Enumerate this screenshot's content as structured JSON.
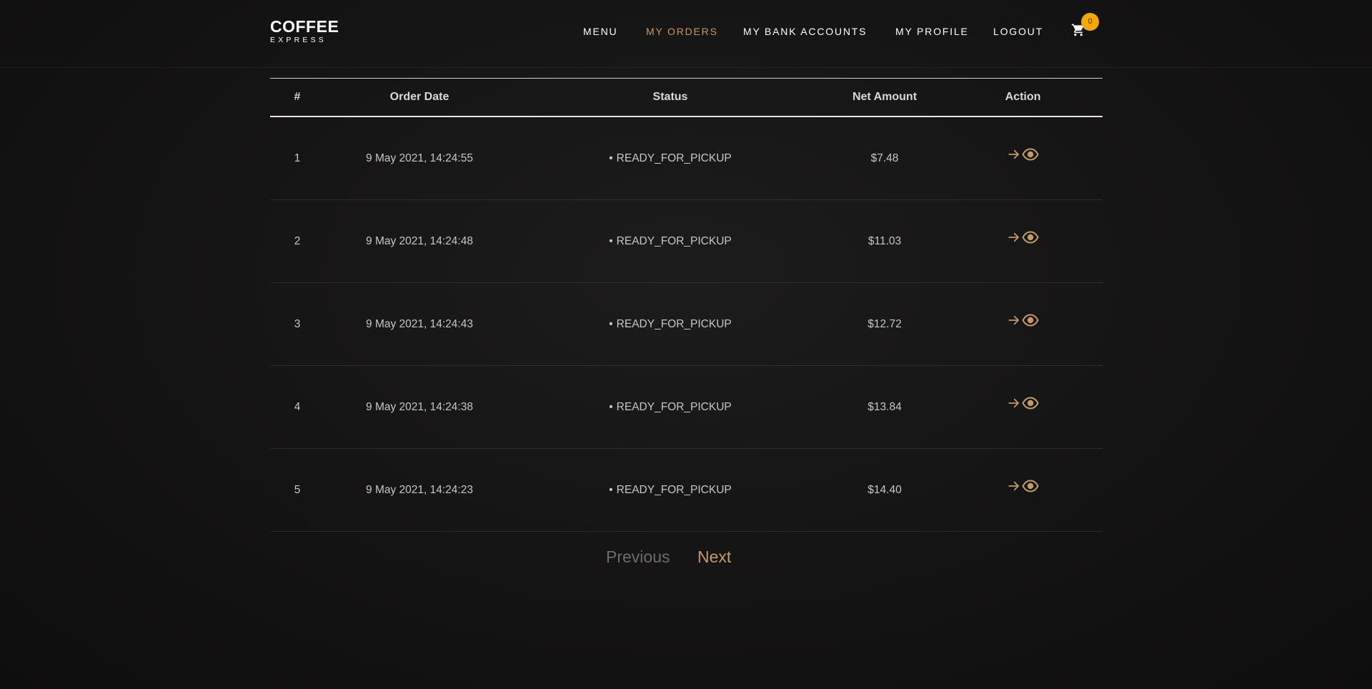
{
  "brand": {
    "name": "COFFEE",
    "tagline": "EXPRESS"
  },
  "nav": {
    "items": [
      {
        "label": "MENU"
      },
      {
        "label": "MY ORDERS"
      },
      {
        "label": "MY BANK ACCOUNTS"
      },
      {
        "label": "MY PROFILE"
      },
      {
        "label": "LOGOUT"
      }
    ],
    "active": "MY ORDERS",
    "cart_icon": "cart-icon",
    "cart_count": "0"
  },
  "table": {
    "headers": [
      "#",
      "Order Date",
      "Status",
      "Net Amount",
      "Action"
    ],
    "rows": [
      {
        "num": "1",
        "date": "9 May 2021, 14:24:55",
        "status": "READY_FOR_PICKUP",
        "amount": "$7.48"
      },
      {
        "num": "2",
        "date": "9 May 2021, 14:24:48",
        "status": "READY_FOR_PICKUP",
        "amount": "$11.03"
      },
      {
        "num": "3",
        "date": "9 May 2021, 14:24:43",
        "status": "READY_FOR_PICKUP",
        "amount": "$12.72"
      },
      {
        "num": "4",
        "date": "9 May 2021, 14:24:38",
        "status": "READY_FOR_PICKUP",
        "amount": "$13.84"
      },
      {
        "num": "5",
        "date": "9 May 2021, 14:24:23",
        "status": "READY_FOR_PICKUP",
        "amount": "$14.40"
      }
    ],
    "status_bullet": "•",
    "action_icons": [
      "arrow-right-icon",
      "eye-icon"
    ]
  },
  "pagination": {
    "previous": "Previous",
    "next": "Next"
  },
  "colors": {
    "accent": "#c49b63",
    "badge": "#f2a900",
    "background": "#151414"
  }
}
